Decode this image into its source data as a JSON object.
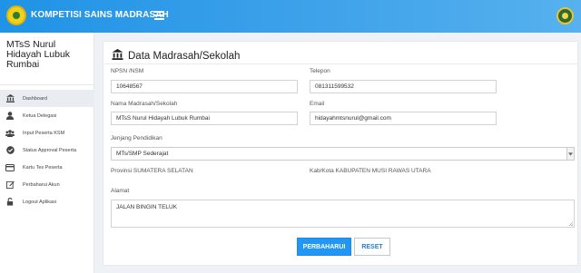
{
  "header": {
    "app_title": "KOMPETISI SAINS MADRASAH",
    "logo_icon": "madrasah-logo-icon",
    "menu_icon": "hamburger-icon",
    "user_icon": "user-avatar-icon"
  },
  "sidebar": {
    "school_name": "MTsS Nurul Hidayah Lubuk Rumbai",
    "items": [
      {
        "label": "Dashboard",
        "icon": "bank-icon",
        "active": true
      },
      {
        "label": "Ketua Delegasi",
        "icon": "user-icon"
      },
      {
        "label": "Input Peserta KSM",
        "icon": "users-icon"
      },
      {
        "label": "Status Approval Peserta",
        "icon": "check-circle-icon"
      },
      {
        "label": "Kartu Tes Peserta",
        "icon": "credit-card-icon"
      },
      {
        "label": "Perbaharui Akun",
        "icon": "edit-icon"
      },
      {
        "label": "Logout Aplikasi",
        "icon": "unlock-icon"
      }
    ]
  },
  "panel": {
    "title": "Data Madrasah/Sekolah",
    "title_icon": "bank-icon",
    "form": {
      "npsn_label": "NPSN /NSM",
      "npsn_value": "10648567",
      "phone_label": "Telepon",
      "phone_value": "081311599532",
      "name_label": "Nama Madrasah/Sekolah",
      "name_value": "MTsS Nurul Hidayah Lubuk Rumbai",
      "email_label": "Email",
      "email_value": "hidayahmtsnurul@gmail.com",
      "level_label": "Jenjang Pendidikan",
      "level_value": "MTs/SMP Sederajat",
      "province_text": "Provinsi SUMATERA SELATAN",
      "regency_text": "Kab/Kota KABUPATEN MUSI RAWAS UTARA",
      "address_label": "Alamat",
      "address_value": "JALAN BINGIN TELUK"
    },
    "buttons": {
      "update": "PERBAHARUI",
      "reset": "RESET"
    }
  },
  "colors": {
    "header_start": "#1f93e6",
    "header_end": "#56b1ee",
    "primary_button": "#2196f3"
  }
}
